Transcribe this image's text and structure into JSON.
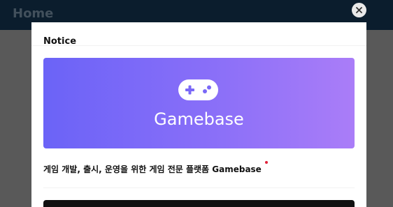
{
  "page": {
    "title": "Home"
  },
  "modal": {
    "title": "Notice",
    "banner_text": "Gamebase",
    "caption": "게임 개발, 출시, 운영을 위한 게임 전문 플랫폼 Gamebase"
  },
  "colors": {
    "topbar": "#0b1d2d",
    "overlay": "#595959",
    "banner_start": "#6b63f7",
    "banner_end": "#aa7df8",
    "notification_dot": "#e0223a"
  },
  "icons": {
    "close": "close-icon",
    "banner": "gamepad-icon"
  }
}
